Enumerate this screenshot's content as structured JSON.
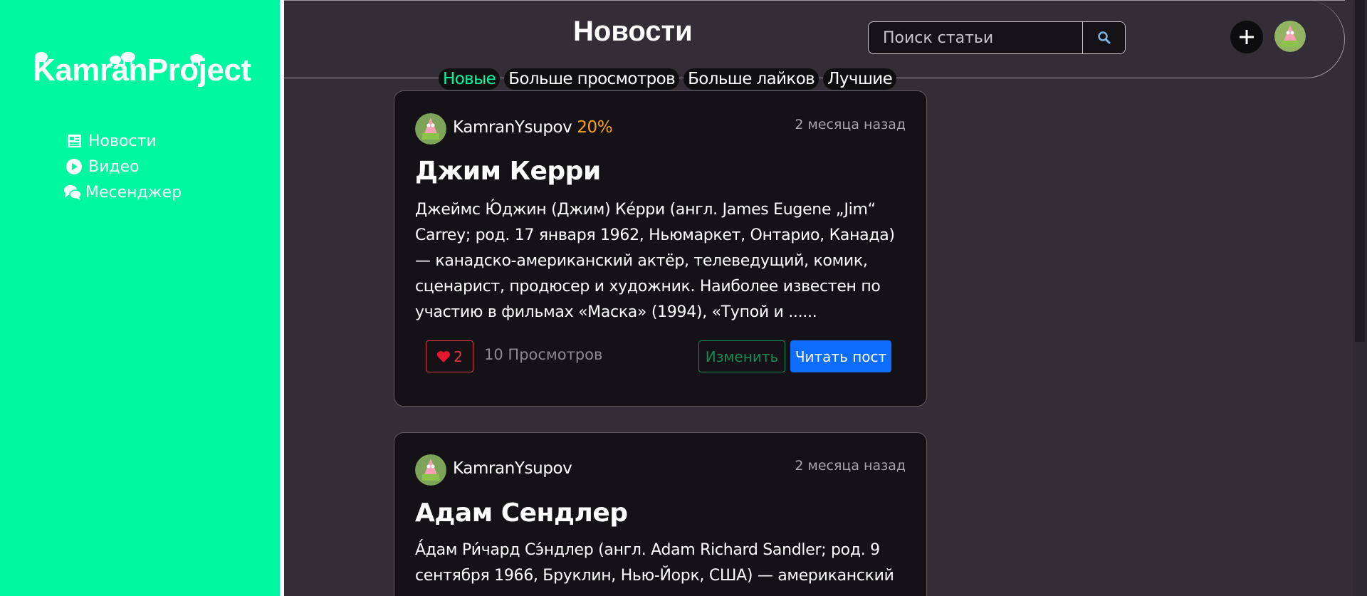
{
  "brand": {
    "name": "KamranProject",
    "accent": "#00f9a0"
  },
  "sidebar": {
    "items": [
      {
        "label": "Новости",
        "icon": "newspaper-icon"
      },
      {
        "label": "Видео",
        "icon": "play-circle-icon"
      },
      {
        "label": "Месенджер",
        "icon": "chat-icon"
      }
    ]
  },
  "header": {
    "title": "Новости",
    "search_placeholder": "Поиск статьи",
    "search_icon": "magnifier-icon",
    "add_icon": "plus-icon"
  },
  "tabs": [
    {
      "label": "Новые",
      "active": true
    },
    {
      "label": "Больше просмотров",
      "active": false
    },
    {
      "label": "Больше лайков",
      "active": false
    },
    {
      "label": "Лучшие",
      "active": false
    }
  ],
  "posts": [
    {
      "author": "KamranYsupov",
      "percent": "20%",
      "time": "2 месяца назад",
      "title": "Джим Керри",
      "text": "Джеймс Ю́джин (Джим) Ке́рри (англ. James Eugene „Jim“ Carrey; род. 17 января 1962, Ньюмаркет, Онтарио, Канада) — канадско-американский актёр, телеведущий, комик, сценарист, продюсер и художник. Наиболее известен по участию в фильмах «Маска» (1994), «Тупой и ......",
      "likes": "2",
      "views": "10 Просмотров",
      "edit_label": "Изменить",
      "read_label": "Читать пост"
    },
    {
      "author": "KamranYsupov",
      "percent": "",
      "time": "2 месяца назад",
      "title": "Адам Сендлер",
      "text": "А́дам Ри́чард Сэ́ндлер (англ. Adam Richard Sandler; род. 9 сентября 1966, Бруклин, Нью-Йорк, США) — американский"
    }
  ]
}
